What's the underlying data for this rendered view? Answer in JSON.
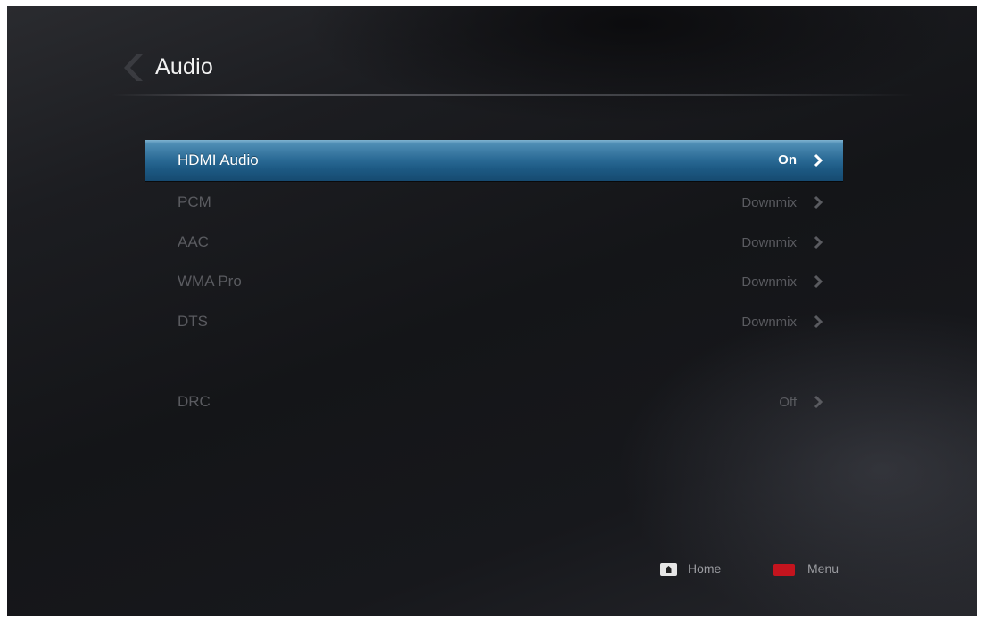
{
  "header": {
    "title": "Audio",
    "back_icon": "chevron-left-icon"
  },
  "settings": [
    {
      "label": "HDMI Audio",
      "value": "On",
      "selected": true
    },
    {
      "label": "PCM",
      "value": "Downmix",
      "selected": false
    },
    {
      "label": "AAC",
      "value": "Downmix",
      "selected": false
    },
    {
      "label": "WMA Pro",
      "value": "Downmix",
      "selected": false
    },
    {
      "label": "DTS",
      "value": "Downmix",
      "selected": false
    },
    {
      "label": "DRC",
      "value": "Off",
      "selected": false
    }
  ],
  "footer": {
    "home_label": "Home",
    "home_icon": "home-icon",
    "menu_label": "Menu",
    "menu_color": "#c4141e"
  },
  "colors": {
    "selection_blue": "#2a6a95",
    "dim_text": "#5a5b60"
  }
}
